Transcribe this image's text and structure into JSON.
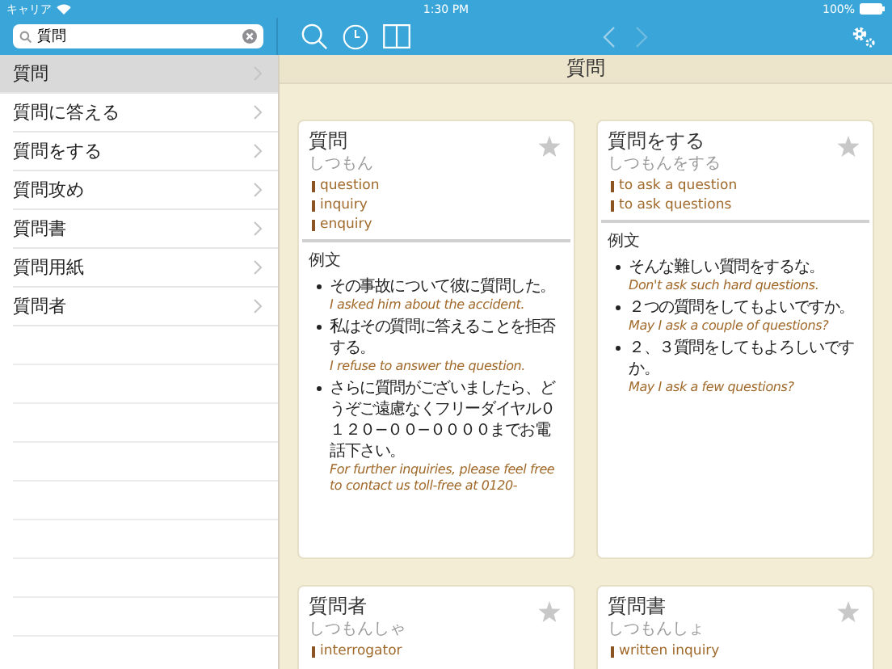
{
  "status_bar": {
    "carrier": "キャリア",
    "time": "1:30 PM",
    "battery": "100%"
  },
  "search": {
    "value": "質問"
  },
  "results": [
    {
      "label": "質問",
      "selected": true
    },
    {
      "label": "質問に答える",
      "selected": false
    },
    {
      "label": "質問をする",
      "selected": false
    },
    {
      "label": "質問攻め",
      "selected": false
    },
    {
      "label": "質問書",
      "selected": false
    },
    {
      "label": "質問用紙",
      "selected": false
    },
    {
      "label": "質問者",
      "selected": false
    }
  ],
  "header_title": "質問",
  "cards": [
    {
      "headword": "質問",
      "reading": "しつもん",
      "favorite": false,
      "translations": [
        "question",
        "inquiry",
        "enquiry"
      ],
      "examples_heading": "例文",
      "examples": [
        {
          "ja": "その事故について彼に質問した。",
          "en": "I asked him about the accident."
        },
        {
          "ja": "私はその質問に答えることを拒否する。",
          "en": "I refuse to answer the question."
        },
        {
          "ja": "さらに質問がございましたら、どうぞご遠慮なくフリーダイヤル０１２０−００−００００までお電話下さい。",
          "en": "For further inquiries, please feel free to contact us toll-free at 0120-"
        }
      ]
    },
    {
      "headword": "質問をする",
      "reading": "しつもんをする",
      "favorite": false,
      "translations": [
        "to ask a question",
        "to ask questions"
      ],
      "examples_heading": "例文",
      "examples": [
        {
          "ja": "そんな難しい質問をするな。",
          "en": "Don't ask such hard questions."
        },
        {
          "ja": "２つの質問をしてもよいですか。",
          "en": "May I ask a couple of questions?"
        },
        {
          "ja": "２、３質問をしてもよろしいですか。",
          "en": "May I ask a few questions?"
        }
      ]
    },
    {
      "headword": "質問者",
      "reading": "しつもんしゃ",
      "favorite": false,
      "translations": [
        "interrogator"
      ]
    },
    {
      "headword": "質問書",
      "reading": "しつもんしょ",
      "favorite": false,
      "translations": [
        "written inquiry"
      ]
    }
  ]
}
